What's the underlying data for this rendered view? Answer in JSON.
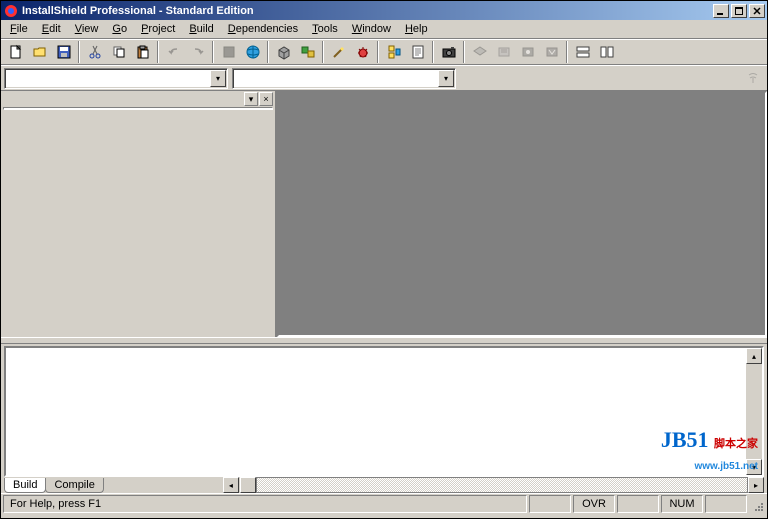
{
  "title": "InstallShield Professional - Standard Edition",
  "menus": [
    "File",
    "Edit",
    "View",
    "Go",
    "Project",
    "Build",
    "Dependencies",
    "Tools",
    "Window",
    "Help"
  ],
  "menu_accel": [
    0,
    0,
    0,
    0,
    0,
    0,
    0,
    0,
    0,
    0
  ],
  "tabs": {
    "build": "Build",
    "compile": "Compile"
  },
  "status": {
    "help": "For Help, press F1",
    "ovr": "OVR",
    "num": "NUM"
  },
  "watermark": {
    "logo": "JB51",
    "cn": "脚本之家",
    "url": "www.jb51.net"
  },
  "toolbar_names": [
    "new-icon",
    "open-icon",
    "save-icon",
    "|",
    "cut-icon",
    "copy-icon",
    "paste-icon",
    "|",
    "undo-icon",
    "redo-icon",
    "|",
    "stop-icon",
    "globe-icon",
    "|",
    "box-icon",
    "component-icon",
    "|",
    "wizard-icon",
    "debug-icon",
    "|",
    "registry-icon",
    "properties-icon",
    "|",
    "camera-icon",
    "|",
    "layer1-icon",
    "layer2-icon",
    "layer3-icon",
    "layer4-icon",
    "|",
    "tile-horiz-icon",
    "tile-vert-icon"
  ],
  "colors": {
    "titlebar_start": "#0a246a",
    "titlebar_end": "#a6caf0",
    "face": "#d4d0c8",
    "workspace": "#808080"
  }
}
